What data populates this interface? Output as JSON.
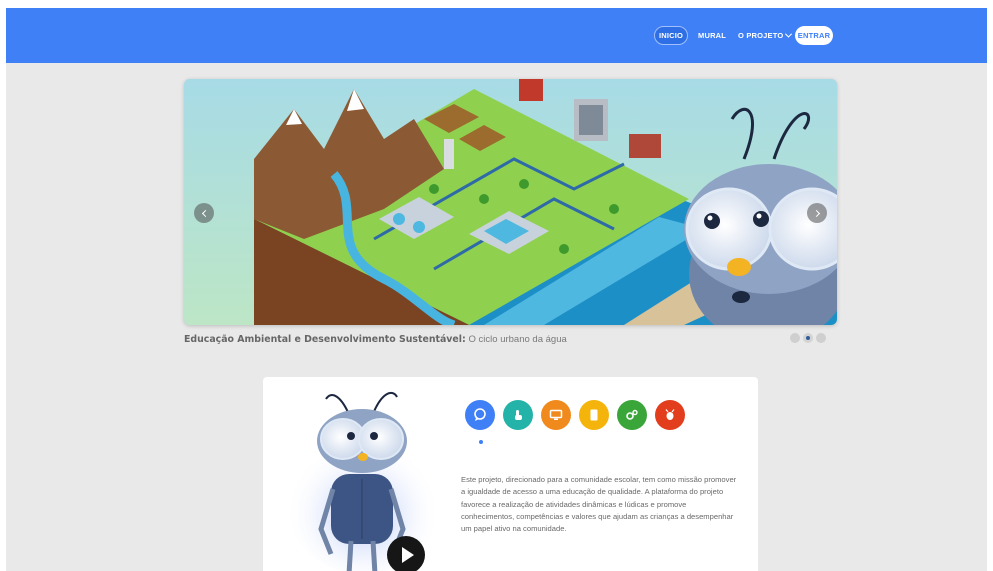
{
  "nav": {
    "items": [
      {
        "label": "INICIO"
      },
      {
        "label": "MURAL"
      },
      {
        "label": "O PROJETO"
      }
    ],
    "login_label": "ENTRAR"
  },
  "carousel": {
    "caption_title": "Educação Ambiental e Desenvolvimento Sustentável:",
    "caption_subtitle": "O ciclo urbano da água",
    "slide_count": 3,
    "active_slide": 2
  },
  "features": {
    "icons": [
      {
        "name": "chat-bubble-icon",
        "color": "#3f80f6"
      },
      {
        "name": "tap-hand-icon",
        "color": "#24b3a8"
      },
      {
        "name": "screen-icon",
        "color": "#f08a1c"
      },
      {
        "name": "tablet-icon",
        "color": "#f5b40b"
      },
      {
        "name": "gears-icon",
        "color": "#3aa63a"
      },
      {
        "name": "bug-icon",
        "color": "#e23d1d"
      }
    ],
    "active_index": 0
  },
  "description": "Este projeto, direcionado para a comunidade escolar, tem como missão promover a igualdade de acesso a uma educação de qualidade. A plataforma do projeto favorece a realização de atividades dinâmicas e lúdicas e promove conhecimentos, competências e valores que ajudam as crianças a desempenhar um papel ativo na comunidade.",
  "colors": {
    "brand_blue": "#3f80f6",
    "page_bg": "#e9e9e9"
  }
}
